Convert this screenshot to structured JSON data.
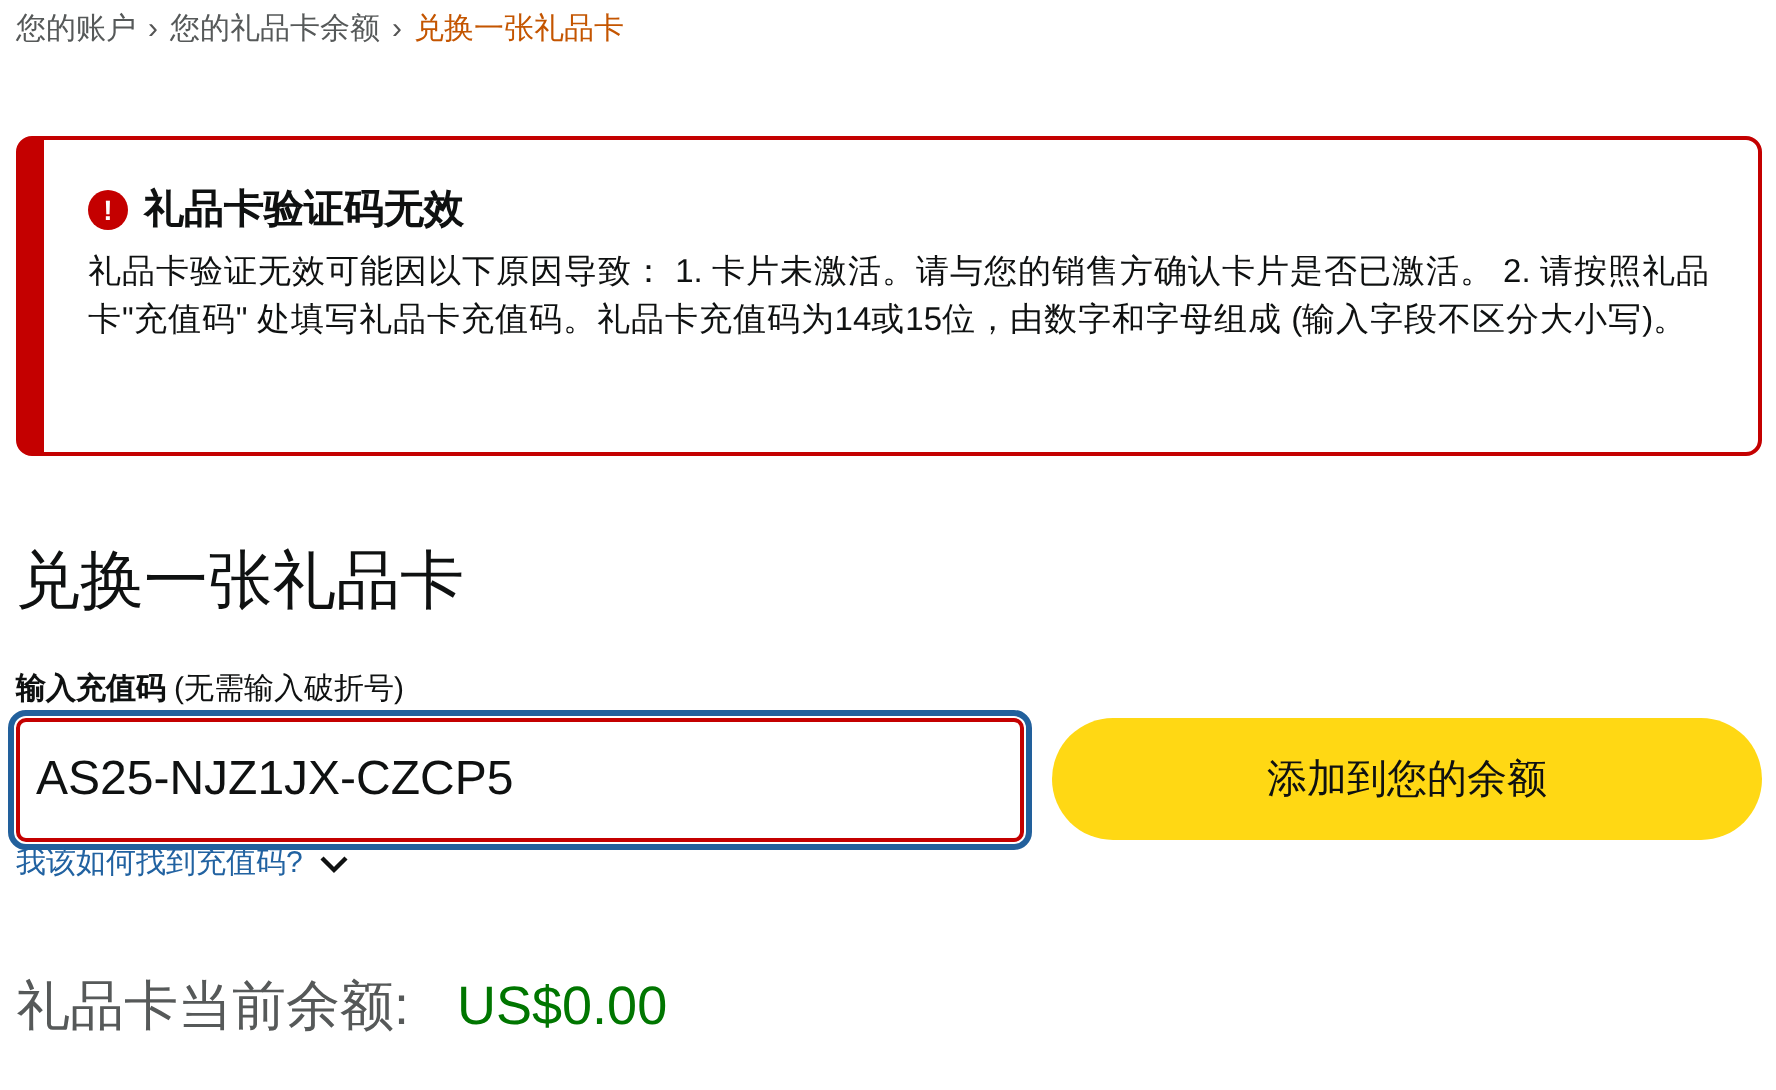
{
  "breadcrumb": [
    {
      "kind": "link",
      "label": "您的账户",
      "selected": false
    },
    {
      "kind": "separator",
      "label": "›"
    },
    {
      "kind": "link",
      "label": "您的礼品卡余额",
      "selected": false
    },
    {
      "kind": "separator",
      "label": "›"
    },
    {
      "kind": "link",
      "label": "兑换一张礼品卡",
      "selected": true
    }
  ],
  "alert": {
    "kind": "error",
    "title": "礼品卡验证码无效",
    "icon": "!",
    "body": "礼品卡验证无效可能因以下原因导致： 1. 卡片未激活。请与您的销售方确认卡片是否已激活。 2. 请按照礼品卡\"充值码\" 处填写礼品卡充值码。礼品卡充值码为14或15位，由数字和字母组成 (输入字段不区分大小写)。"
  },
  "heading": "兑换一张礼品卡",
  "claim_field": {
    "label": "输入充值码",
    "hint": "(无需输入破折号)",
    "value": "AS25-NJZ1JX-CZCP5",
    "error": true,
    "focused": true
  },
  "add_button": "添加到您的余额",
  "help_link": "我该如何找到充值码?",
  "balance": {
    "label": "礼品卡当前余额:",
    "amount": "US$0.00"
  }
}
